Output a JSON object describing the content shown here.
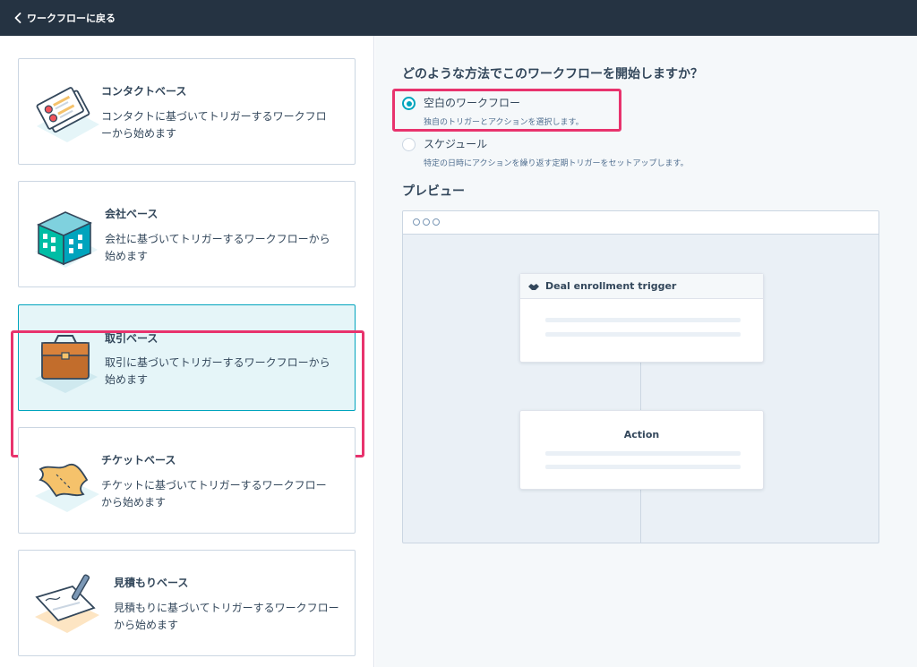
{
  "topbar": {
    "back_label": "ワークフローに戻る"
  },
  "cards": [
    {
      "title": "コンタクトベース",
      "desc": "コンタクトに基づいてトリガーするワークフローから始めます",
      "icon": "contact-cards-icon"
    },
    {
      "title": "会社ベース",
      "desc": "会社に基づいてトリガーするワークフローから始めます",
      "icon": "company-building-icon"
    },
    {
      "title": "取引ベース",
      "desc": "取引に基づいてトリガーするワークフローから始めます",
      "icon": "deal-briefcase-icon",
      "selected": true
    },
    {
      "title": "チケットベース",
      "desc": "チケットに基づいてトリガーするワークフローから始めます",
      "icon": "ticket-icon"
    },
    {
      "title": "見積もりベース",
      "desc": "見積もりに基づいてトリガーするワークフローから始めます",
      "icon": "quote-document-icon"
    }
  ],
  "start": {
    "question": "どのような方法でこのワークフローを開始しますか？",
    "options": [
      {
        "label": "空白のワークフロー",
        "help": "独自のトリガーとアクションを選択します。",
        "checked": true
      },
      {
        "label": "スケジュール",
        "help": "特定の日時にアクションを繰り返す定期トリガーをセットアップします。",
        "checked": false
      }
    ]
  },
  "preview": {
    "title": "プレビュー",
    "trigger_label": "Deal enrollment trigger",
    "action_label": "Action"
  },
  "colors": {
    "accent": "#00a4bd",
    "highlight": "#e8336d",
    "topbar": "#253342"
  }
}
